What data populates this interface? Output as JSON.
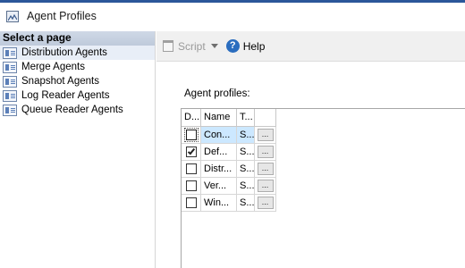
{
  "window": {
    "title": "Agent Profiles",
    "icon": "window-app-icon"
  },
  "sidebar": {
    "header": "Select a page",
    "items": [
      {
        "label": "Distribution Agents",
        "selected": true,
        "icon": "page-icon"
      },
      {
        "label": "Merge Agents",
        "selected": false,
        "icon": "page-icon"
      },
      {
        "label": "Snapshot Agents",
        "selected": false,
        "icon": "page-icon"
      },
      {
        "label": "Log Reader Agents",
        "selected": false,
        "icon": "page-icon"
      },
      {
        "label": "Queue Reader Agents",
        "selected": false,
        "icon": "page-icon"
      }
    ]
  },
  "toolbar": {
    "script_label": "Script",
    "script_enabled": false,
    "help_label": "Help",
    "help_glyph": "?"
  },
  "main": {
    "section_label": "Agent profiles:",
    "grid": {
      "columns": [
        "D...",
        "Name",
        "T..."
      ],
      "rows": [
        {
          "default": false,
          "name": "Con...",
          "type": "S...",
          "button": "...",
          "selected": true
        },
        {
          "default": true,
          "name": "Def...",
          "type": "S...",
          "button": "...",
          "selected": false
        },
        {
          "default": false,
          "name": "Distr...",
          "type": "S...",
          "button": "...",
          "selected": false
        },
        {
          "default": false,
          "name": "Ver...",
          "type": "S...",
          "button": "...",
          "selected": false
        },
        {
          "default": false,
          "name": "Win...",
          "type": "S...",
          "button": "...",
          "selected": false
        }
      ]
    }
  },
  "colors": {
    "accent": "#2b579a",
    "selection": "#cce8ff",
    "sidebar_header": "#c8d2e2"
  }
}
